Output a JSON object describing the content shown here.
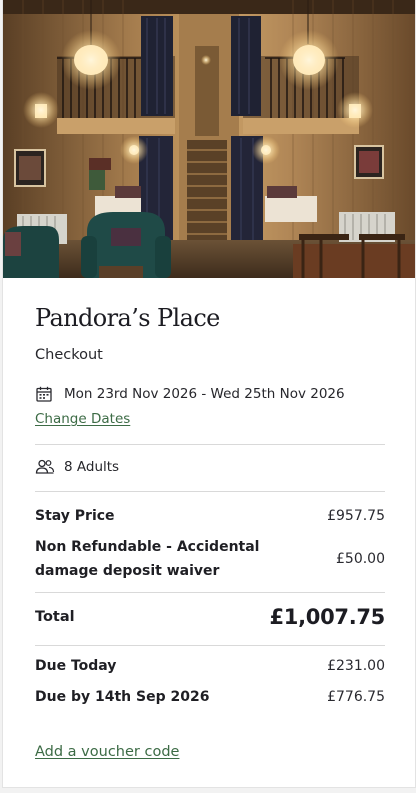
{
  "listing": {
    "image_alt": "Interior of a timber lodge with mezzanine bunk areas and a central staircase",
    "title": "Pandora’s Place"
  },
  "checkout": {
    "heading": "Checkout",
    "dates_text": "Mon 23rd Nov 2026 - Wed 25th Nov 2026",
    "change_dates_label": "Change Dates",
    "guests_text": "8 Adults"
  },
  "pricing": {
    "stay_price_label": "Stay Price",
    "stay_price_value": "£957.75",
    "waiver_label": "Non Refundable - Accidental damage deposit waiver",
    "waiver_value": "£50.00",
    "total_label": "Total",
    "total_value": "£1,007.75",
    "due_today_label": "Due Today",
    "due_today_value": "£231.00",
    "due_later_label": "Due by 14th Sep 2026",
    "due_later_value": "£776.75"
  },
  "voucher": {
    "label": "Add a voucher code"
  },
  "icons": {
    "dates": "calendar-icon",
    "guests": "guests-icon"
  },
  "colors": {
    "link": "#3c6b45",
    "text": "#1f1f24",
    "divider": "#d9d9d9"
  }
}
